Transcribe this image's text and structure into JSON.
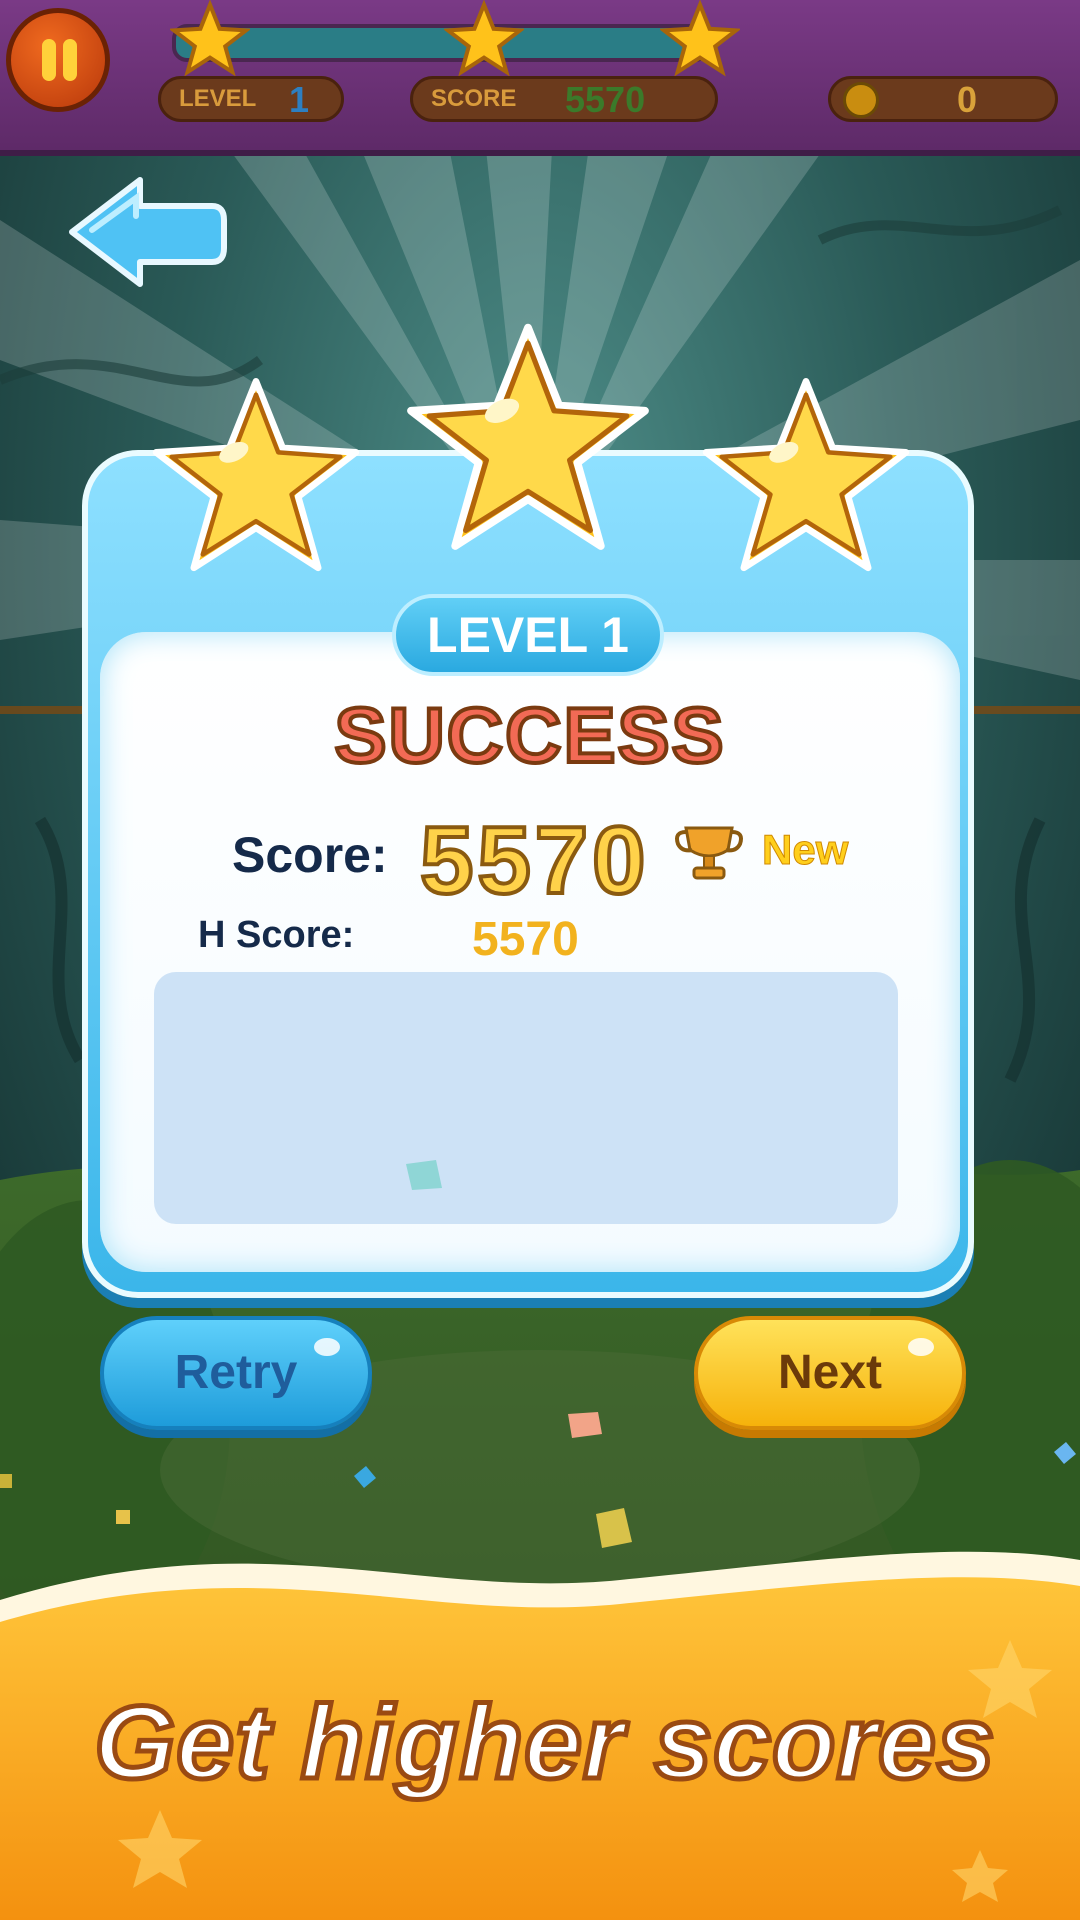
{
  "hud": {
    "level_label": "LEVEL",
    "level_value": "1",
    "score_label": "SCORE",
    "score_value": "5570",
    "coins_value": "0",
    "progress_stars_earned": 3,
    "progress_stars_total": 3
  },
  "result": {
    "level_title": "LEVEL 1",
    "status": "SUCCESS",
    "stars_earned": 3,
    "stars_total": 3,
    "score_label": "Score:",
    "score_value": "5570",
    "new_badge": "New",
    "high_score_label": "H Score:",
    "high_score_value": "5570"
  },
  "buttons": {
    "retry": "Retry",
    "next": "Next"
  },
  "banner": {
    "text": "Get higher scores"
  },
  "colors": {
    "hud_bg": "#6b3277",
    "panel_blue": "#3bb6ea",
    "star_gold": "#ffc21a",
    "retry_blue": "#1e9cda",
    "next_yellow": "#f6b20b",
    "banner_orange": "#f79a12",
    "success_red": "#f26a55"
  },
  "icons": [
    "pause-icon",
    "back-arrow-icon",
    "star-icon",
    "coin-icon",
    "trophy-icon"
  ]
}
